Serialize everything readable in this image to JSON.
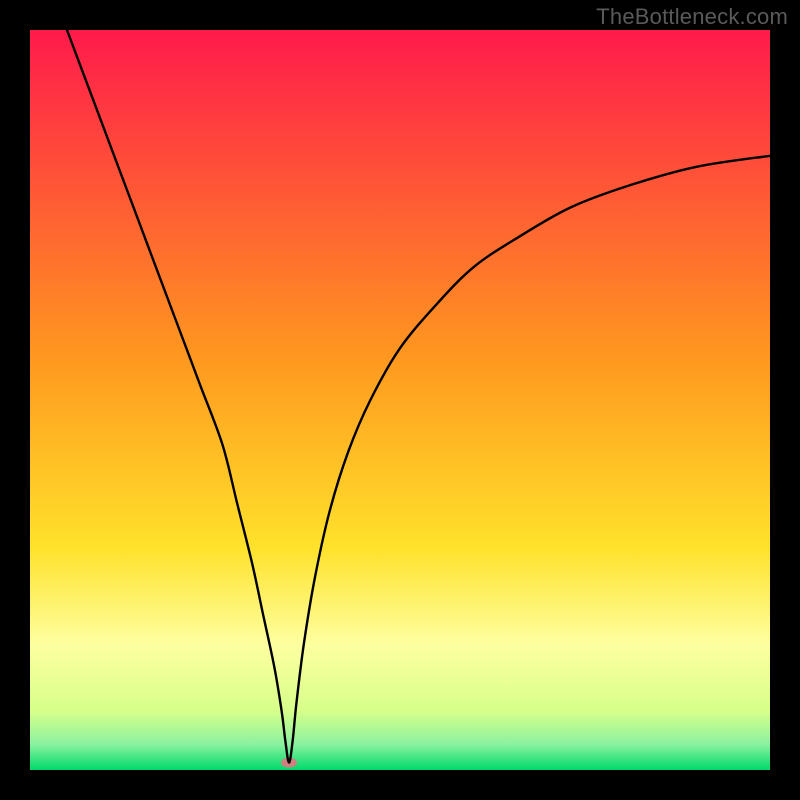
{
  "watermark": "TheBottleneck.com",
  "chart_data": {
    "type": "line",
    "title": "",
    "xlabel": "",
    "ylabel": "",
    "xlim": [
      0,
      100
    ],
    "ylim": [
      0,
      100
    ],
    "background_gradient": {
      "top_color": "#ff1a4b",
      "mid_color": "#ffd400",
      "bottom_color_1": "#f8ffb0",
      "bottom_color_2": "#00e676",
      "stops": [
        {
          "offset": 0.0,
          "color": "#ff1a4b"
        },
        {
          "offset": 0.45,
          "color": "#ff9a1f"
        },
        {
          "offset": 0.7,
          "color": "#ffe22b"
        },
        {
          "offset": 0.83,
          "color": "#feffa0"
        },
        {
          "offset": 0.92,
          "color": "#d7ff8a"
        },
        {
          "offset": 0.965,
          "color": "#8cf2a0"
        },
        {
          "offset": 1.0,
          "color": "#00d96a"
        }
      ]
    },
    "series": [
      {
        "name": "bottleneck_curve",
        "x": [
          5,
          8,
          11,
          14,
          17,
          20,
          23,
          26,
          28,
          30,
          31.5,
          33,
          34,
          34.5,
          35,
          35.5,
          36,
          37,
          38.5,
          40.5,
          43,
          46,
          50,
          55,
          60,
          66,
          73,
          81,
          90,
          100
        ],
        "y": [
          100,
          92,
          84,
          76,
          68,
          60,
          52,
          44,
          36,
          28,
          21,
          14,
          8,
          4,
          1,
          4,
          9,
          17,
          26,
          35,
          43,
          50,
          57,
          63,
          68,
          72,
          76,
          79,
          81.5,
          83
        ]
      }
    ],
    "marker": {
      "x": 35,
      "y": 1,
      "color": "#d08080",
      "rx": 8,
      "ry": 5
    }
  }
}
